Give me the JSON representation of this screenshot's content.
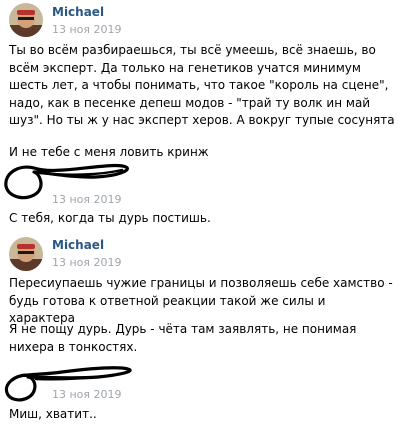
{
  "messages": [
    {
      "author": "Michael",
      "time": "13 ноя 2019",
      "paragraphs": [
        "Ты во всём разбираешься, ты всё умеешь, всё знаешь, во всём эксперт. Да только на генетиков учатся минимум шесть лет, а чтобы понимать, что такое \"король на сцене\", надо, как в песенке депеш модов - \"трай ту волк ин май шуз\". Но ты ж у нас эксперт херов. А вокруг тупые сосунята",
        "И не тебе с меня ловить кринж"
      ]
    },
    {
      "author": "",
      "time": "13 ноя 2019",
      "paragraphs": [
        "С тебя, когда ты дурь постишь."
      ]
    },
    {
      "author": "Michael",
      "time": "13 ноя 2019",
      "paragraphs": [
        "Пересиупаешь чужие границы и позволяешь себе хамство - будь готова к ответной реакции такой же силы и характера",
        "Я не пощу дурь. Дурь - чёта там заявлять, не понимая нихера в тонкостях."
      ]
    },
    {
      "author": "",
      "time": "13 ноя 2019",
      "paragraphs": [
        "Миш, хватит.."
      ]
    }
  ],
  "colors": {
    "author_name": "#2a5885",
    "timestamp": "#a0a6ad",
    "text": "#000000",
    "background": "#ffffff"
  },
  "icons": {
    "avatar": "user-avatar-icon",
    "redaction": "scribble-redaction"
  }
}
